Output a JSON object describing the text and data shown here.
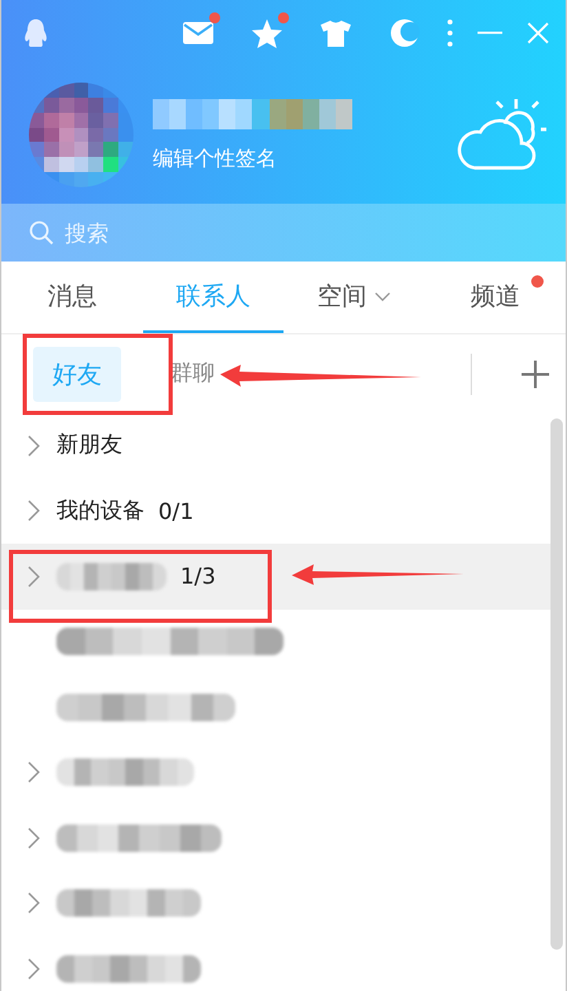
{
  "header": {
    "signature": "编辑个性签名",
    "toolbar": [
      {
        "kind": "mail",
        "badge": true
      },
      {
        "kind": "star",
        "badge": true
      },
      {
        "kind": "shirt",
        "badge": false
      },
      {
        "kind": "moon",
        "badge": false
      }
    ]
  },
  "search": {
    "placeholder": "搜索"
  },
  "tabs": [
    {
      "label": "消息",
      "selected": false,
      "dropdown": false,
      "badge": false
    },
    {
      "label": "联系人",
      "selected": true,
      "dropdown": false,
      "badge": false
    },
    {
      "label": "空间",
      "selected": false,
      "dropdown": true,
      "badge": false
    },
    {
      "label": "频道",
      "selected": false,
      "dropdown": false,
      "badge": true
    }
  ],
  "subtabs": [
    {
      "label": "好友",
      "selected": true
    },
    {
      "label": "群聊",
      "selected": false
    }
  ],
  "groups": [
    {
      "name": "新朋友",
      "chevron": true,
      "highlighted": false
    },
    {
      "name": "我的设备",
      "count": "0/1",
      "chevron": true,
      "highlighted": false
    },
    {
      "count": "1/3",
      "chevron": true,
      "highlighted": true
    },
    {
      "chevron": false,
      "highlighted": false
    },
    {
      "chevron": false,
      "highlighted": false
    },
    {
      "chevron": true,
      "highlighted": false
    },
    {
      "chevron": true,
      "highlighted": false
    },
    {
      "chevron": true,
      "highlighted": false
    },
    {
      "chevron": true,
      "highlighted": false
    }
  ]
}
